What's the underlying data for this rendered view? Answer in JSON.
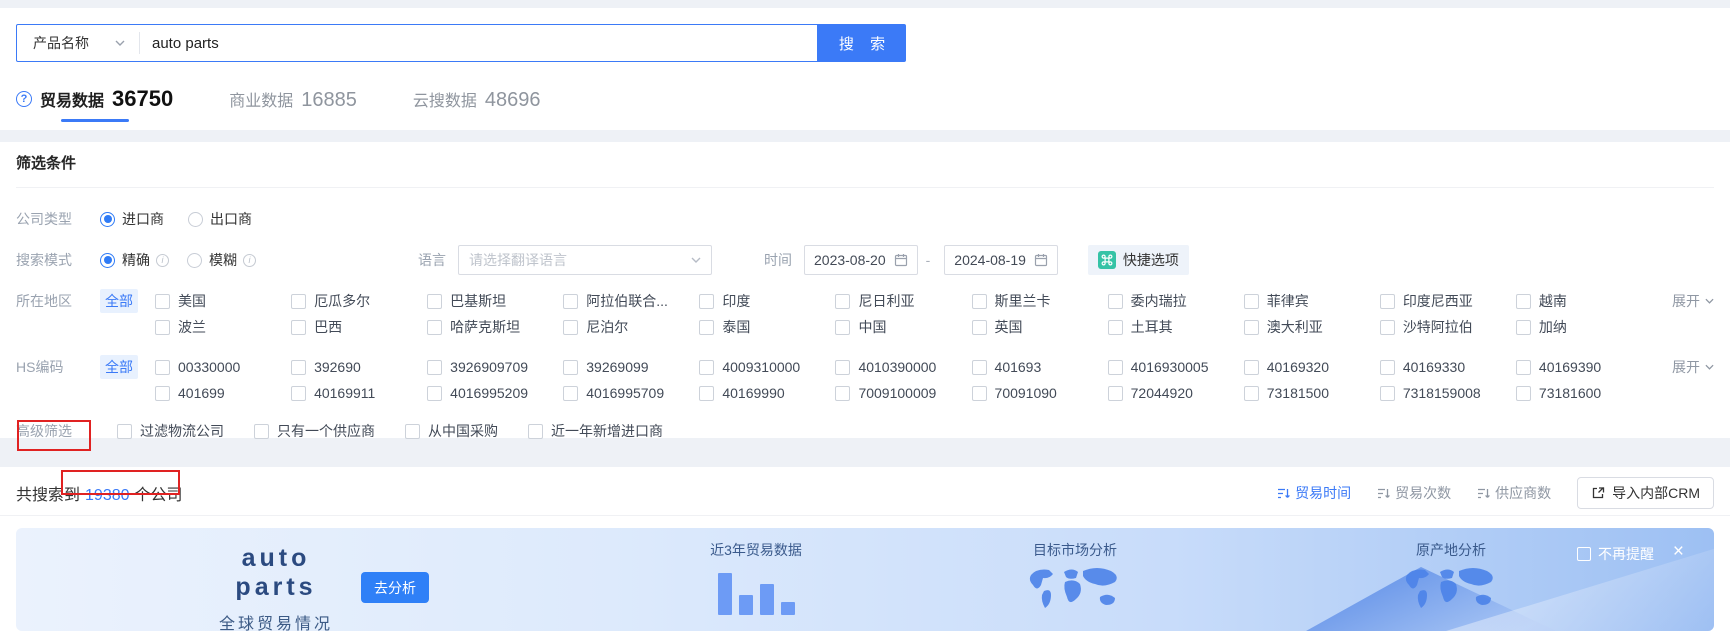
{
  "search": {
    "category_label": "产品名称",
    "query": "auto parts",
    "button_label": "搜 索"
  },
  "tabs": [
    {
      "label": "贸易数据",
      "count": "36750",
      "active": true
    },
    {
      "label": "商业数据",
      "count": "16885",
      "active": false
    },
    {
      "label": "云搜数据",
      "count": "48696",
      "active": false
    }
  ],
  "filters": {
    "title": "筛选条件",
    "company_type": {
      "label": "公司类型",
      "options": [
        "进口商",
        "出口商"
      ],
      "selected": "进口商"
    },
    "search_mode": {
      "label": "搜索模式",
      "options": [
        "精确",
        "模糊"
      ],
      "selected": "精确"
    },
    "language": {
      "label": "语言",
      "placeholder": "请选择翻译语言"
    },
    "time": {
      "label": "时间",
      "start": "2023-08-20",
      "separator": "-",
      "end": "2024-08-19"
    },
    "quick_option_label": "快捷选项",
    "region": {
      "label": "所在地区",
      "all_label": "全部",
      "row1": [
        "美国",
        "厄瓜多尔",
        "巴基斯坦",
        "阿拉伯联合...",
        "印度",
        "尼日利亚",
        "斯里兰卡",
        "委内瑞拉",
        "菲律宾",
        "印度尼西亚",
        "越南"
      ],
      "row2": [
        "波兰",
        "巴西",
        "哈萨克斯坦",
        "尼泊尔",
        "泰国",
        "中国",
        "英国",
        "土耳其",
        "澳大利亚",
        "沙特阿拉伯",
        "加纳"
      ],
      "expand_label": "展开"
    },
    "hs_code": {
      "label": "HS编码",
      "all_label": "全部",
      "row1": [
        "00330000",
        "392690",
        "3926909709",
        "39269099",
        "4009310000",
        "4010390000",
        "401693",
        "4016930005",
        "40169320",
        "40169330",
        "40169390"
      ],
      "row2": [
        "401699",
        "40169911",
        "4016995209",
        "4016995709",
        "40169990",
        "7009100009",
        "70091090",
        "72044920",
        "73181500",
        "7318159008",
        "73181600"
      ],
      "expand_label": "展开"
    },
    "advanced": {
      "label": "高级筛选",
      "options": [
        "过滤物流公司",
        "只有一个供应商",
        "从中国采购",
        "近一年新增进口商"
      ]
    }
  },
  "results": {
    "summary_prefix": "共搜索到",
    "count": "19380",
    "summary_suffix": "个公司",
    "sorts": [
      "贸易时间",
      "贸易次数",
      "供应商数"
    ],
    "active_sort": "贸易时间",
    "crm_button_label": "导入内部CRM"
  },
  "banner": {
    "title": "auto parts",
    "subtitle": "全球贸易情况",
    "analyze_button_label": "去分析",
    "item1_title": "近3年贸易数据",
    "item2_title": "目标市场分析",
    "item3_title": "原产地分析",
    "dismiss_label": "不再提醒",
    "close_glyph": "×",
    "chart_bars": [
      42,
      20,
      31,
      13
    ]
  },
  "icons": {
    "help": "?",
    "info": "i"
  },
  "colors": {
    "primary_blue": "#3b7af7",
    "teal_icon": "#35c3a6",
    "annotation_red": "#e02222",
    "banner_text_navy": "#2b4a80"
  }
}
